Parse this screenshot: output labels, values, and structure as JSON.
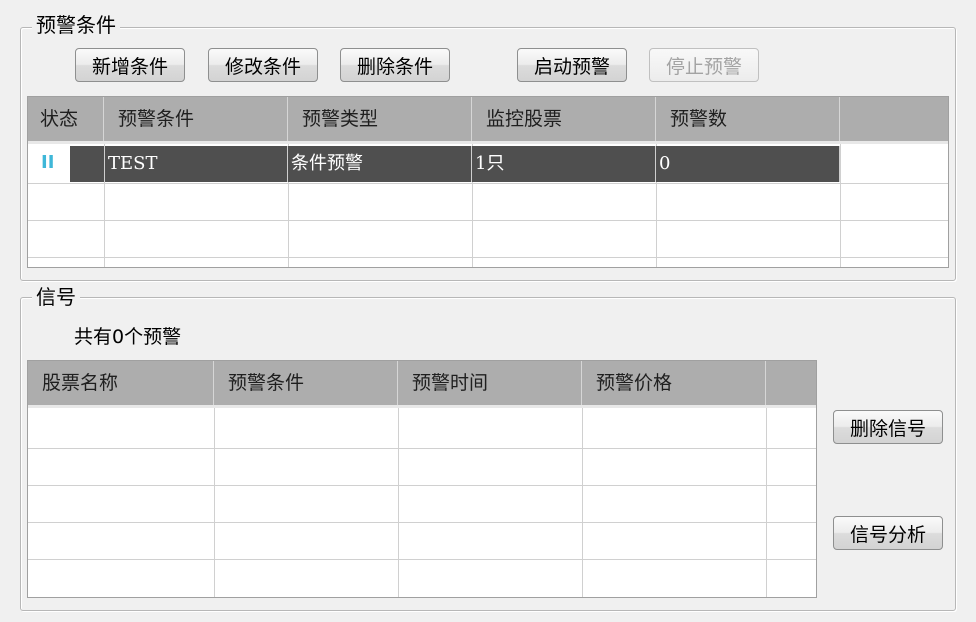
{
  "conditions_group": {
    "title": "预警条件",
    "buttons": {
      "add": "新增条件",
      "edit": "修改条件",
      "delete": "删除条件",
      "start": "启动预警",
      "stop": "停止预警"
    },
    "columns": [
      "状态",
      "预警条件",
      "预警类型",
      "监控股票",
      "预警数"
    ],
    "rows": [
      {
        "status_icon": "pause-icon",
        "status_glyph": "II",
        "condition": "TEST",
        "type": "条件预警",
        "stocks": "1只",
        "count": "0"
      }
    ]
  },
  "signals_group": {
    "title": "信号",
    "count_text": "共有0个预警",
    "columns": [
      "股票名称",
      "预警条件",
      "预警时间",
      "预警价格"
    ],
    "rows": [],
    "buttons": {
      "delete_signal": "删除信号",
      "analyze_signal": "信号分析"
    }
  },
  "colors": {
    "header_bg": "#adadad",
    "selected_row_bg": "#4f4f4f",
    "status_icon": "#3fb7d8"
  }
}
